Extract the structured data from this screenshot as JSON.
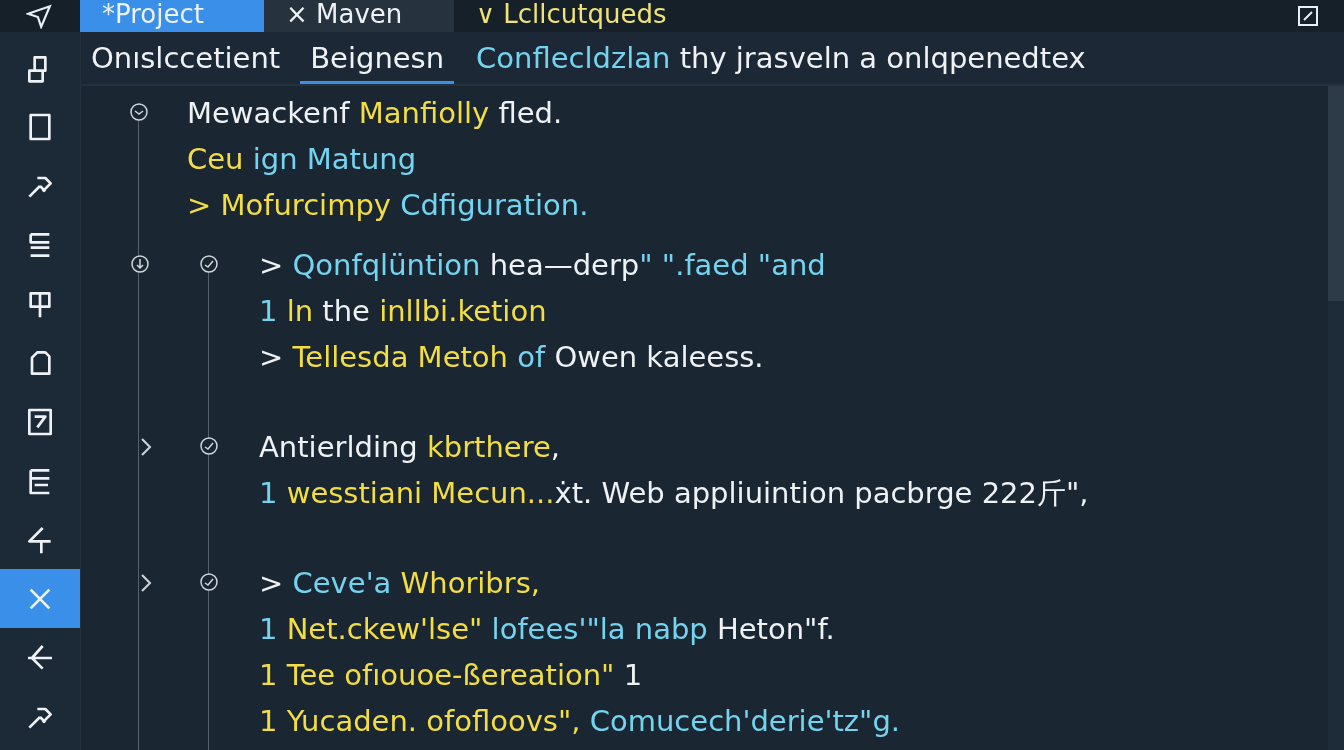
{
  "top_tabs": [
    {
      "label": "*Project",
      "selected": true
    },
    {
      "label": "× Maven",
      "selected": false
    },
    {
      "label": "∨ Lcllcutqueds",
      "selected": false
    }
  ],
  "sub_tabs": [
    {
      "label": "Onıslccetient",
      "selected": false
    },
    {
      "label": "Beignesn",
      "selected": true
    }
  ],
  "message": [
    {
      "kind": "type",
      "text": "Conflecldzlan"
    },
    {
      "kind": "plain",
      "text": " thy jrasveln a onlqpenedtex"
    }
  ],
  "sidebar": {
    "items": [
      {
        "selected": false
      },
      {
        "selected": false
      },
      {
        "selected": false
      },
      {
        "selected": false
      },
      {
        "selected": false
      },
      {
        "selected": false
      },
      {
        "selected": false
      },
      {
        "selected": false
      },
      {
        "selected": false
      },
      {
        "selected": true
      },
      {
        "selected": false
      },
      {
        "selected": false
      }
    ]
  },
  "editor": {
    "lines": [
      [
        {
          "kind": "plain",
          "text": "Mewackenf "
        },
        {
          "kind": "keyword",
          "text": "Manfiolly"
        },
        {
          "kind": "plain",
          "text": " fled."
        }
      ],
      [
        {
          "kind": "keyword",
          "text": "Ceu"
        },
        {
          "kind": "type",
          "text": " ign Matung"
        }
      ],
      [
        {
          "kind": "keyword",
          "text": "> Mofurcimpy "
        },
        {
          "kind": "type",
          "text": "Cdfiguration."
        }
      ]
    ],
    "children": [
      {
        "kind": "dot",
        "lines": [
          [
            {
              "kind": "plain",
              "text": "> "
            },
            {
              "kind": "type",
              "text": "Qonfqlüntion "
            },
            {
              "kind": "plain",
              "text": "hea—derp"
            },
            {
              "kind": "type",
              "text": "\" \".faed \"and"
            }
          ],
          [
            {
              "kind": "type",
              "text": "1 "
            },
            {
              "kind": "keyword",
              "text": "ln "
            },
            {
              "kind": "plain",
              "text": "the "
            },
            {
              "kind": "keyword",
              "text": "inllbi.ketion"
            }
          ],
          [
            {
              "kind": "plain",
              "text": "> "
            },
            {
              "kind": "keyword",
              "text": "Tellesda Metoh "
            },
            {
              "kind": "type",
              "text": "of "
            },
            {
              "kind": "plain",
              "text": "Owen kaleess."
            }
          ]
        ]
      },
      {
        "kind": "chevron",
        "lines": [
          [
            {
              "kind": "plain",
              "text": "Antierlding "
            },
            {
              "kind": "keyword",
              "text": "kbrthere"
            },
            {
              "kind": "plain",
              "text": ","
            }
          ],
          [
            {
              "kind": "type",
              "text": "1 "
            },
            {
              "kind": "keyword",
              "text": "wesstiani Mecun..."
            },
            {
              "kind": "plain",
              "text": "ẋt. Web appliuintion pacbrge 222斤\","
            }
          ]
        ]
      },
      {
        "kind": "chevron",
        "lines": [
          [
            {
              "kind": "plain",
              "text": "> "
            },
            {
              "kind": "type",
              "text": "Ceve'a "
            },
            {
              "kind": "keyword",
              "text": "Whoribrs,"
            }
          ],
          [
            {
              "kind": "type",
              "text": "1 "
            },
            {
              "kind": "keyword",
              "text": "Net.ckew'lse\" "
            },
            {
              "kind": "type",
              "text": "lofees'\"la nabp "
            },
            {
              "kind": "plain",
              "text": "Heton\"f."
            }
          ],
          [
            {
              "kind": "keyword",
              "text": "1 Tee ofıouoe-ßereation\" "
            },
            {
              "kind": "plain",
              "text": "1"
            }
          ],
          [
            {
              "kind": "keyword",
              "text": "1 Yucaden. ofofloovs\", "
            },
            {
              "kind": "type",
              "text": "Comucech'derie'tz\"g."
            }
          ]
        ]
      }
    ]
  }
}
